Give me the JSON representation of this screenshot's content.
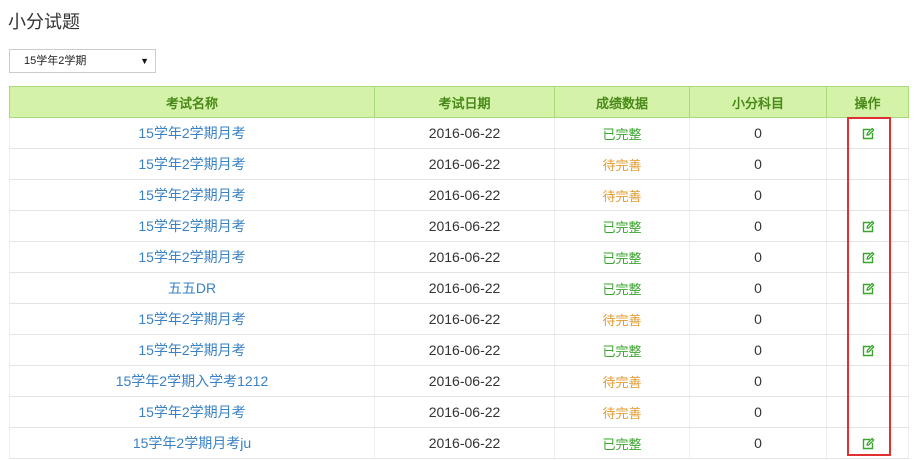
{
  "page": {
    "title": "小分试题"
  },
  "semester_select": {
    "selected": "15学年2学期"
  },
  "table": {
    "headers": [
      "考试名称",
      "考试日期",
      "成绩数据",
      "小分科目",
      "操作"
    ],
    "rows": [
      {
        "name": "15学年2学期月考",
        "date": "2016-06-22",
        "status": "已完整",
        "status_type": "done",
        "count": "0",
        "editable": true
      },
      {
        "name": "15学年2学期月考",
        "date": "2016-06-22",
        "status": "待完善",
        "status_type": "todo",
        "count": "0",
        "editable": false
      },
      {
        "name": "15学年2学期月考",
        "date": "2016-06-22",
        "status": "待完善",
        "status_type": "todo",
        "count": "0",
        "editable": false
      },
      {
        "name": "15学年2学期月考",
        "date": "2016-06-22",
        "status": "已完整",
        "status_type": "done",
        "count": "0",
        "editable": true
      },
      {
        "name": "15学年2学期月考",
        "date": "2016-06-22",
        "status": "已完整",
        "status_type": "done",
        "count": "0",
        "editable": true
      },
      {
        "name": "五五DR",
        "date": "2016-06-22",
        "status": "已完整",
        "status_type": "done",
        "count": "0",
        "editable": true
      },
      {
        "name": "15学年2学期月考",
        "date": "2016-06-22",
        "status": "待完善",
        "status_type": "todo",
        "count": "0",
        "editable": false
      },
      {
        "name": "15学年2学期月考",
        "date": "2016-06-22",
        "status": "已完整",
        "status_type": "done",
        "count": "0",
        "editable": true
      },
      {
        "name": "15学年2学期入学考1212",
        "date": "2016-06-22",
        "status": "待完善",
        "status_type": "todo",
        "count": "0",
        "editable": false
      },
      {
        "name": "15学年2学期月考",
        "date": "2016-06-22",
        "status": "待完善",
        "status_type": "todo",
        "count": "0",
        "editable": false
      },
      {
        "name": "15学年2学期月考ju",
        "date": "2016-06-22",
        "status": "已完整",
        "status_type": "done",
        "count": "0",
        "editable": true
      }
    ]
  },
  "colors": {
    "header_bg": "#d4f2a8",
    "header_text": "#4a8a1a",
    "link": "#3a82c4",
    "done": "#3aa52e",
    "todo": "#e29a2e",
    "highlight": "#e03030"
  },
  "icons": {
    "edit": "edit-icon",
    "dropdown": "caret-down-icon"
  }
}
